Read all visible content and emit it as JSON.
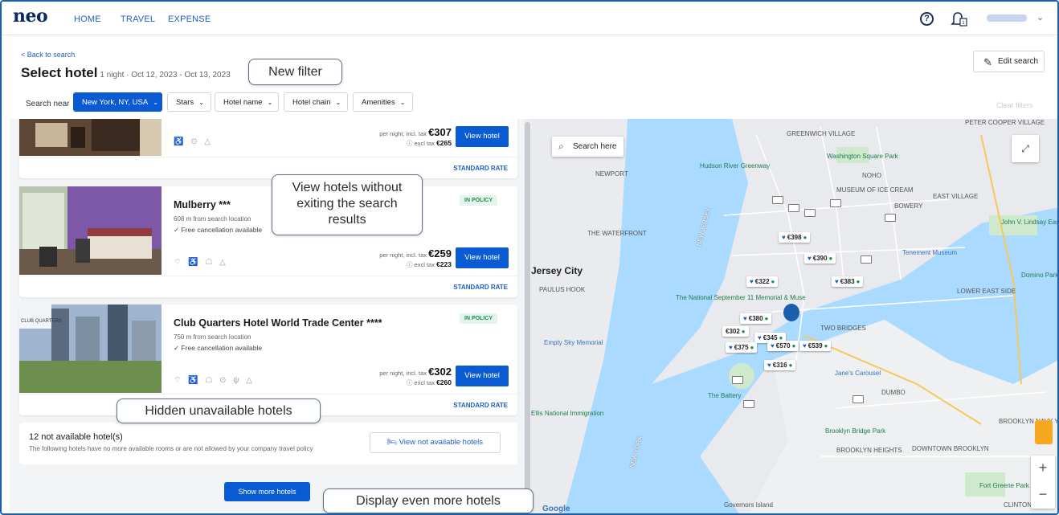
{
  "nav": {
    "logo": "neo",
    "links": [
      "HOME",
      "TRAVEL",
      "EXPENSE"
    ],
    "help_icon": "question-circle-icon",
    "notification_icon": "bell-notification-icon"
  },
  "header": {
    "back_link": "< Back to search",
    "title": "Select hotel",
    "subtitle": "1 night · Oct 12, 2023 - Oct 13, 2023",
    "edit_search": "Edit search"
  },
  "filters": {
    "search_near_label": "Search near",
    "location": "New York, NY, USA",
    "stars": "Stars",
    "hotel_name": "Hotel name",
    "hotel_chain": "Hotel chain",
    "amenities": "Amenities",
    "clear": "Clear filters"
  },
  "hotels": [
    {
      "name": "",
      "amenities": "♿ ⊙ △",
      "price_label": "per night, incl. tax",
      "price": "€307",
      "excl_label": "excl tax",
      "excl_price": "€265",
      "view_label": "View hotel",
      "rate": "STANDARD RATE"
    },
    {
      "name": "Mulberry ***",
      "distance": "608 m from search location",
      "cancellation": "✓  Free cancellation available",
      "badge": "IN POLICY",
      "amenities": "⌔ ♿ ☖ △",
      "price_label": "per night, incl. tax",
      "price": "€259",
      "excl_label": "excl tax",
      "excl_price": "€223",
      "view_label": "View hotel",
      "rate": "STANDARD RATE"
    },
    {
      "name": "Club Quarters Hotel World Trade Center ****",
      "distance": "750 m from search location",
      "cancellation": "✓  Free cancellation available",
      "badge": "IN POLICY",
      "logo_text": "CLUB QUARTERS",
      "amenities": "⌔ ♿ ☖ ⊙ ψ △",
      "price_label": "per night, incl. tax",
      "price": "€302",
      "excl_label": "excl tax",
      "excl_price": "€260",
      "view_label": "View hotel",
      "rate": "STANDARD RATE"
    }
  ],
  "not_available": {
    "title": "12 not available hotel(s)",
    "description": "The following hotels have no more available rooms or are not allowed by your company travel policy",
    "button": "View not available hotels"
  },
  "show_more": "Show more hotels",
  "map": {
    "search_label": "Search here",
    "labels": [
      "PETER COOPER VILLAGE",
      "GREENWICH VILLAGE",
      "Washington Square Park",
      "NOHO",
      "Hudson River Greenway",
      "NEWPORT",
      "MUSEUM OF ICE CREAM",
      "BOWERY",
      "EAST VILLAGE",
      "THE WATERFRONT",
      "Jersey City",
      "PAULUS HOOK",
      "John V. Lindsay East River Park",
      "Tenement Museum",
      "Domino Park",
      "LOWER EAST SIDE",
      "The National September 11 Memorial & Muse",
      "TWO BRIDGES",
      "Empty Sky Memorial",
      "Jane's Carousel",
      "DUMBO",
      "The Battery",
      "Ellis National Immigration",
      "BROOKLYN NAVY YARD",
      "Brooklyn Bridge Park",
      "BROOKLYN HEIGHTS",
      "DOWNTOWN BROOKLYN",
      "Fort Greene Park",
      "CLINTON",
      "NEW JERSEY",
      "NEW YORK",
      "Governors Island",
      "Google"
    ],
    "prices": [
      "€398",
      "€390",
      "€322",
      "€383",
      "€380",
      "€302",
      "€345",
      "€375",
      "€570",
      "€539",
      "€316"
    ]
  },
  "callouts": {
    "new_filter": "New filter",
    "view_hotels": "View hotels without exiting the search results",
    "hidden": "Hidden unavailable hotels",
    "display_more": "Display even more hotels"
  },
  "colors": {
    "primary": "#0a5bd3",
    "water": "#aadaff",
    "green_badge": "#1b8d4f"
  }
}
